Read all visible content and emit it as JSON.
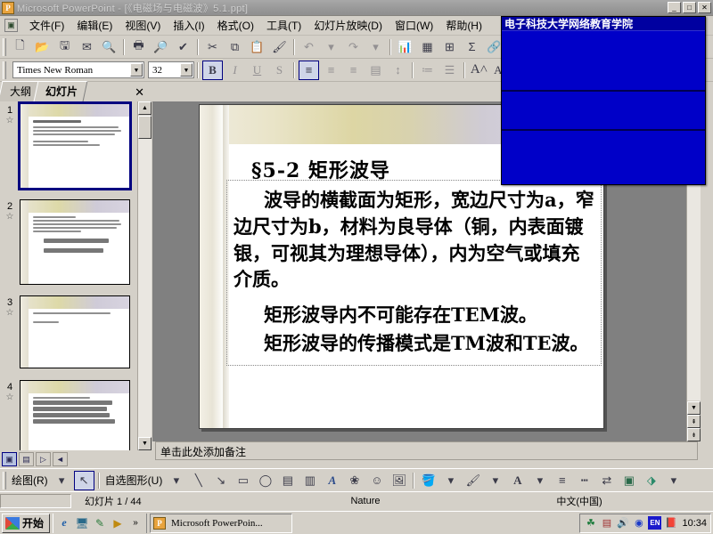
{
  "window": {
    "title": "Microsoft PowerPoint - [《电磁场与电磁波》5.1.ppt]",
    "minimize_label": "_",
    "maximize_label": "□",
    "close_label": "✕"
  },
  "menubar": {
    "doc_icon": "presentation-icon",
    "items": [
      {
        "label": "文件(F)"
      },
      {
        "label": "编辑(E)"
      },
      {
        "label": "视图(V)"
      },
      {
        "label": "插入(I)"
      },
      {
        "label": "格式(O)"
      },
      {
        "label": "工具(T)"
      },
      {
        "label": "幻灯片放映(D)"
      },
      {
        "label": "窗口(W)"
      },
      {
        "label": "帮助(H)"
      }
    ]
  },
  "standard_toolbar": {
    "buttons": [
      {
        "name": "new-file-icon",
        "glyph": "🗋",
        "enabled": true
      },
      {
        "name": "open-folder-icon",
        "glyph": "📂",
        "enabled": true
      },
      {
        "name": "save-icon",
        "glyph": "🖫",
        "enabled": true
      },
      {
        "name": "email-icon",
        "glyph": "✉",
        "enabled": true
      },
      {
        "name": "search-icon",
        "glyph": "🔍",
        "enabled": true
      },
      {
        "name": "print-icon",
        "glyph": "🖶",
        "enabled": true
      },
      {
        "name": "print-preview-icon",
        "glyph": "🔎",
        "enabled": true
      },
      {
        "name": "spelling-check-icon",
        "glyph": "✓",
        "enabled": true
      },
      {
        "name": "cut-icon",
        "glyph": "✂",
        "enabled": true
      },
      {
        "name": "copy-icon",
        "glyph": "⧉",
        "enabled": true
      },
      {
        "name": "paste-icon",
        "glyph": "📋",
        "enabled": true
      },
      {
        "name": "format-painter-icon",
        "glyph": "🖌",
        "enabled": true
      },
      {
        "name": "undo-icon",
        "glyph": "↶",
        "enabled": false
      },
      {
        "name": "redo-icon",
        "glyph": "↷",
        "enabled": false
      },
      {
        "name": "insert-chart-icon",
        "glyph": "📊",
        "enabled": true
      },
      {
        "name": "insert-table-icon",
        "glyph": "▦",
        "enabled": true
      },
      {
        "name": "insert-excel-table-icon",
        "glyph": "⊞",
        "enabled": true
      },
      {
        "name": "autosum-icon",
        "glyph": "Σ",
        "enabled": true
      },
      {
        "name": "hyperlink-icon",
        "glyph": "🔗",
        "enabled": true
      },
      {
        "name": "expand-all-icon",
        "glyph": "☰",
        "enabled": false
      },
      {
        "name": "show-formatting-icon",
        "glyph": "A",
        "enabled": true
      },
      {
        "name": "grid-icon",
        "glyph": "▩",
        "enabled": false
      }
    ]
  },
  "formatting_toolbar": {
    "font_name": "Times New Roman",
    "font_size": "32",
    "dropdown_arrow": "▼",
    "buttons": [
      {
        "name": "bold-button",
        "glyph": "B",
        "active": true
      },
      {
        "name": "italic-button",
        "glyph": "I",
        "active": false
      },
      {
        "name": "underline-button",
        "glyph": "U",
        "active": false
      },
      {
        "name": "shadow-button",
        "glyph": "S",
        "active": false
      },
      {
        "name": "align-left-button",
        "glyph": "≡",
        "active": true
      },
      {
        "name": "align-center-button",
        "glyph": "≡",
        "active": false
      },
      {
        "name": "align-right-button",
        "glyph": "≡",
        "active": false
      },
      {
        "name": "justify-button",
        "glyph": "▤",
        "active": false
      },
      {
        "name": "line-spacing-button",
        "glyph": "↕",
        "active": false
      },
      {
        "name": "numbered-list-button",
        "glyph": "≔",
        "active": false
      },
      {
        "name": "bulleted-list-button",
        "glyph": "☰",
        "active": false
      },
      {
        "name": "increase-font-button",
        "glyph": "A",
        "active": false
      },
      {
        "name": "decrease-font-button",
        "glyph": "A",
        "active": false
      },
      {
        "name": "decrease-indent-button",
        "glyph": "⇤",
        "active": false
      }
    ]
  },
  "left_pane": {
    "tabs": [
      {
        "label": "大纲",
        "active": false,
        "name": "tab-outline"
      },
      {
        "label": "幻灯片",
        "active": true,
        "name": "tab-slides"
      }
    ],
    "close_label": "✕",
    "thumbnails": [
      {
        "number": "1",
        "selected": true,
        "star": "☆"
      },
      {
        "number": "2",
        "selected": false,
        "star": "☆"
      },
      {
        "number": "3",
        "selected": false,
        "star": "☆"
      },
      {
        "number": "4",
        "selected": false,
        "star": "☆"
      }
    ],
    "scroll_up": "▲",
    "scroll_down": "▼"
  },
  "slide": {
    "title": "§5-2  矩形波导",
    "paragraphs": [
      "波导的横截面为矩形，宽边尺寸为a，窄边尺寸为b，材料为良导体（铜，内表面镀银，可视其为理想导体），内为空气或填充介质。",
      "矩形波导内不可能存在TEM波。",
      "矩形波导的传播模式是TM波和TE波。"
    ]
  },
  "notes": {
    "placeholder": "单击此处添加备注"
  },
  "view_buttons": [
    {
      "name": "normal-view-button",
      "glyph": "▣",
      "active": true
    },
    {
      "name": "slide-sorter-view-button",
      "glyph": "▤",
      "active": false
    },
    {
      "name": "slide-show-button",
      "glyph": "▷",
      "active": false
    },
    {
      "name": "pane-resize-handle",
      "glyph": "◄",
      "active": false
    }
  ],
  "drawing_toolbar": {
    "draw_menu": "绘图(R)",
    "autoshapes_menu": "自选图形(U)",
    "menu_arrow": "▾",
    "buttons": [
      {
        "name": "select-objects-icon",
        "glyph": "↖",
        "active": true
      },
      {
        "name": "line-icon",
        "glyph": "╲",
        "active": false
      },
      {
        "name": "arrow-icon",
        "glyph": "↘",
        "active": false
      },
      {
        "name": "rectangle-icon",
        "glyph": "▭",
        "active": false
      },
      {
        "name": "oval-icon",
        "glyph": "◯",
        "active": false
      },
      {
        "name": "text-box-icon",
        "glyph": "▤",
        "active": false
      },
      {
        "name": "vertical-text-box-icon",
        "glyph": "▥",
        "active": false
      },
      {
        "name": "insert-wordart-icon",
        "glyph": "A",
        "active": false
      },
      {
        "name": "insert-diagram-icon",
        "glyph": "❀",
        "active": false
      },
      {
        "name": "insert-clipart-icon",
        "glyph": "👤",
        "active": false
      },
      {
        "name": "insert-picture-icon",
        "glyph": "🖼",
        "active": false
      },
      {
        "name": "fill-color-icon",
        "glyph": "🪣",
        "active": false
      },
      {
        "name": "line-color-icon",
        "glyph": "🖌",
        "active": false
      },
      {
        "name": "font-color-icon",
        "glyph": "A",
        "active": false
      },
      {
        "name": "line-style-icon",
        "glyph": "≡",
        "active": false
      },
      {
        "name": "dash-style-icon",
        "glyph": "┄",
        "active": false
      },
      {
        "name": "arrow-style-icon",
        "glyph": "⇄",
        "active": false
      },
      {
        "name": "shadow-style-icon",
        "glyph": "▣",
        "active": false
      },
      {
        "name": "3d-style-icon",
        "glyph": "⬗",
        "active": false
      }
    ]
  },
  "statusbar": {
    "slide_counter": "幻灯片 1 / 44",
    "design_template": "Nature",
    "language": "中文(中国)"
  },
  "taskbar": {
    "start_label": "开始",
    "quick_launch": [
      {
        "name": "internet-explorer-icon",
        "glyph": "e"
      },
      {
        "name": "show-desktop-icon",
        "glyph": "🖥"
      },
      {
        "name": "outlook-express-icon",
        "glyph": "✎"
      },
      {
        "name": "media-player-icon",
        "glyph": "▶"
      },
      {
        "name": "quick-launch-overflow",
        "glyph": "»"
      }
    ],
    "task_button": "Microsoft PowerPoin...",
    "tray_icons": [
      {
        "name": "antivirus-icon",
        "glyph": "☘"
      },
      {
        "name": "usb-device-icon",
        "glyph": "🖧"
      },
      {
        "name": "volume-icon",
        "glyph": "🔊"
      },
      {
        "name": "media-tray-icon",
        "glyph": "◉"
      },
      {
        "name": "input-language-icon",
        "glyph": "EN"
      },
      {
        "name": "ime-toolbar-icon",
        "glyph": "📕"
      }
    ],
    "clock": "10:34"
  },
  "overlay_window": {
    "title": "电子科技大学网络教育学院",
    "background_color": "#0000c8",
    "title_color": "#0000a0"
  }
}
